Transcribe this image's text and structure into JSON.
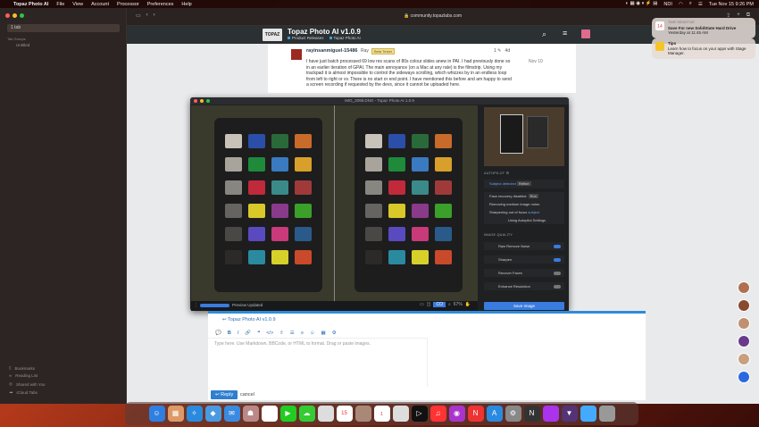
{
  "menubar": {
    "app": "Topaz Photo AI",
    "items": [
      "File",
      "View",
      "Account",
      "Processor",
      "Preferences",
      "Help"
    ],
    "status": [
      "NDI"
    ],
    "datetime": "Tue Nov 15  9:26 PM"
  },
  "browser": {
    "url": "community.topazlabs.com",
    "tab_label": "1 tab",
    "group_label": "Tab Groups",
    "group_item": "Untitled",
    "bottom_links": [
      "Bookmarks",
      "Reading List",
      "Shared with You",
      "iCloud Tabs"
    ]
  },
  "site": {
    "title": "Topaz Photo AI v1.0.9",
    "crumb_parent": "Product Releases",
    "crumb_child": "Topaz Photo AI",
    "logo": "TOPAZ"
  },
  "post": {
    "user": "rayinsanmiguel-15486",
    "display": "Ray",
    "badge": "Beta Tester",
    "count": "1",
    "age": "4d",
    "date": "Nov 10",
    "text": "I have just batch processed 69 low res scans of 80s colour slides anew in PAI. I had previously done so in an earlier iteration of GPAI. The main annoyance (on a Mac at any rate) is the filmstrip. Using my trackpad it is almost impossible to control the sideways scrolling, which whizzes by in an endless loop from left to right or vv. There is no start or end point. I have mentioned this before and am happy to send a screen recording if requested by the devs, since it cannot be uploaded here."
  },
  "app_window": {
    "title": "IMG_2098.DNG - Topaz Photo AI 1.0.9",
    "status": "Preview Updated",
    "zoom": "67%",
    "autopilot_header": "AUTOPILOT",
    "subject_detected": "Subject detected",
    "subject_btn": "Refine",
    "face_recovery": "Face recovery disabled.",
    "face_btn": "Run",
    "removing_noise": "Removing medium image noise.",
    "sharpening": "Sharpening out of focus",
    "sharpening_subject": "subject",
    "autopilot_settings": "Using Autopilot Settings",
    "quality_header": "IMAGE QUALITY",
    "rows": [
      "Raw Remove Noise",
      "Sharpen",
      "Recover Faces",
      "Enhance Resolution"
    ],
    "save": "Save Image",
    "compare_label": "CO"
  },
  "composer": {
    "topic": "Topaz Photo AI v1.0.9",
    "placeholder": "Type here. Use Markdown, BBCode, or HTML to format. Drag or paste images.",
    "reply": "Reply",
    "cancel": "cancel"
  },
  "notifications": [
    {
      "app": "TIME SENSITIVE",
      "title": "Save For new SolidState Hard Drive",
      "sub": "Yesterday at 11:45 AM",
      "icon": "calendar-icon",
      "day": "14"
    },
    {
      "app": "",
      "title": "Tips",
      "sub": "Learn how to focus on your apps with Stage Manager.",
      "icon": "tips-icon",
      "day": ""
    }
  ],
  "dock": {
    "calendar_day": "15",
    "badge": "1"
  }
}
